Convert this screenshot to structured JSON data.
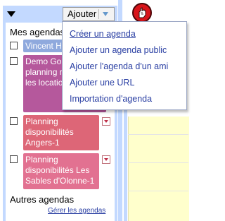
{
  "toolbar": {
    "add_label": "Ajouter"
  },
  "calendars": {
    "my_label": "Mes agendas",
    "other_label": "Autres agendas",
    "manage_link": "Gérer les agendas",
    "items": [
      {
        "name": "Vincent H",
        "color": "#8fa9dd",
        "checked": false
      },
      {
        "name": "Demo Go Calendar planning réservation les location",
        "color": "#b5589c",
        "checked": false
      },
      {
        "name": "Planning disponibilités Angers-1",
        "color": "#dd6677",
        "checked": false
      },
      {
        "name": "Planning disponibilités Les Sables d'Olonne-1",
        "color": "#e27191",
        "checked": false
      }
    ]
  },
  "add_menu": {
    "items": [
      {
        "label": "Créer un agenda"
      },
      {
        "label": "Ajouter un agenda public"
      },
      {
        "label": "Ajouter l'agenda d'un ami"
      },
      {
        "label": "Ajouter une URL"
      },
      {
        "label": "Importation d'agenda"
      }
    ]
  },
  "colors": {
    "panel_blue": "#c3d9ff",
    "link_blue": "#2a3fa3",
    "cursor_red": "#d8141a",
    "today_yellow": "#ffffcc"
  },
  "icons": {
    "collapse": "triangle-down-icon",
    "add_dropdown": "chevron-down-icon",
    "cursor": "hand-pointer-cursor-icon",
    "chip_menu": "chevron-down-icon"
  }
}
